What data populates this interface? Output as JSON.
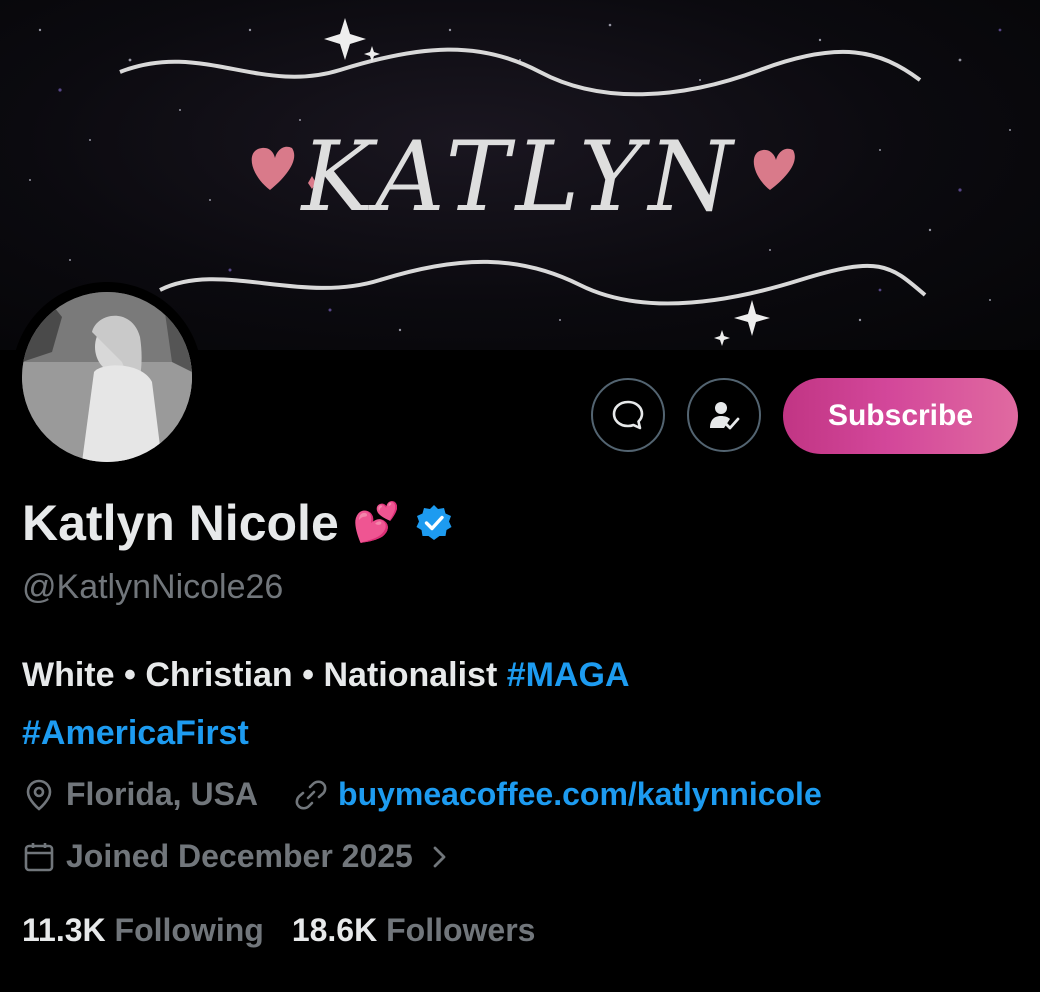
{
  "banner": {
    "title_text": "KATLYN"
  },
  "profile": {
    "name": "Katlyn Nicole",
    "name_emoji": "💕",
    "verified": true,
    "handle": "@KatlynNicole26",
    "bio_text": "White • Christian • Nationalist ",
    "bio_tags": [
      "#MAGA",
      "#AmericaFirst"
    ],
    "location": "Florida, USA",
    "website": "buymeacoffee.com/katlynnicole",
    "joined": "Joined December 2025",
    "following_count": "11.3K",
    "following_label": "Following",
    "followers_count": "18.6K",
    "followers_label": "Followers"
  },
  "actions": {
    "message_icon": "message-icon",
    "subscribe_icon": "person-check-icon",
    "subscribe_label": "Subscribe"
  },
  "colors": {
    "accent": "#1d9bf0",
    "subscribe_gradient_start": "#c13584",
    "subscribe_gradient_end": "#e06aa0",
    "muted": "#71767b"
  }
}
